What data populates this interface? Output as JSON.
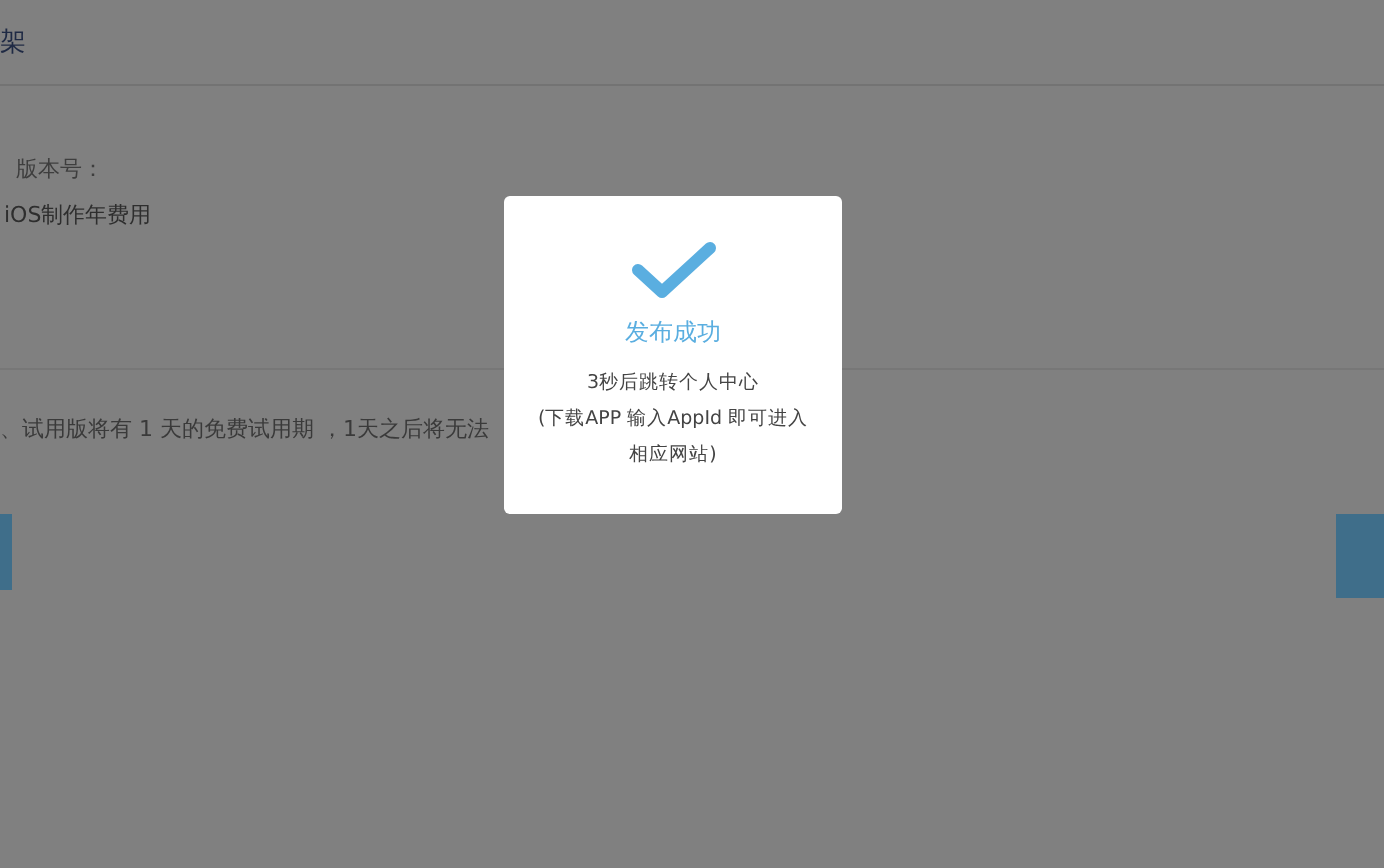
{
  "header": {
    "title": "架"
  },
  "form": {
    "version_label": "版本号：",
    "fee_label": "iOS制作年费用"
  },
  "notice": {
    "text": "、试用版将有 1 天的免费试用期 ，1天之后将无法"
  },
  "dialog": {
    "title": "发布成功",
    "lines": [
      "3秒后跳转个人中心",
      "(下载APP 输入AppId 即可进入相应网站)"
    ]
  }
}
